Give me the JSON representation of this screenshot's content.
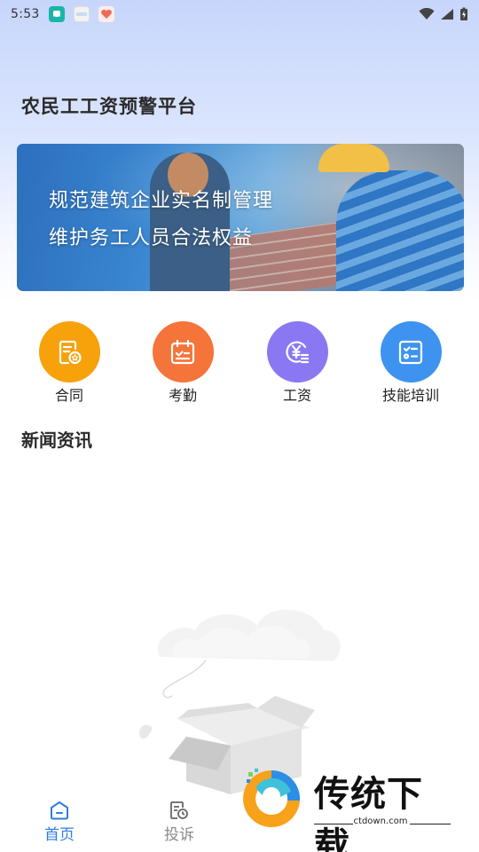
{
  "status_bar": {
    "time": "5:53"
  },
  "app": {
    "title": "农民工工资预警平台"
  },
  "banner": {
    "line1": "规范建筑企业实名制管理",
    "line2": "维护务工人员合法权益"
  },
  "quick_menu": {
    "items": [
      {
        "label": "合同",
        "icon": "contract-icon",
        "color": "#f7a10b"
      },
      {
        "label": "考勤",
        "icon": "calendar-icon",
        "color": "#f4743a"
      },
      {
        "label": "工资",
        "icon": "salary-icon",
        "color": "#8a78f2"
      },
      {
        "label": "技能培训",
        "icon": "checklist-icon",
        "color": "#3d93ef"
      }
    ]
  },
  "news": {
    "title": "新闻资讯"
  },
  "bottom_nav": {
    "items": [
      {
        "label": "首页",
        "icon": "home-icon",
        "active": true
      },
      {
        "label": "投诉",
        "icon": "complaint-icon",
        "active": false
      }
    ]
  },
  "watermark": {
    "text": "传统下载",
    "url": "ctdown.com"
  },
  "colors": {
    "accent": "#2f7de1",
    "inactive": "#8a8a8a"
  }
}
